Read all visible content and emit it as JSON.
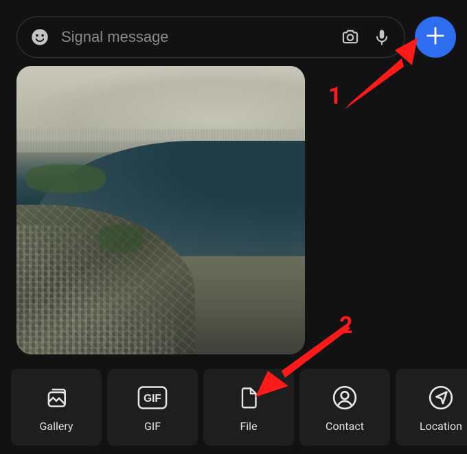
{
  "composer": {
    "placeholder": "Signal message",
    "value": ""
  },
  "plus_button": {
    "accent": "#2e6cf0"
  },
  "attachments": {
    "items": [
      {
        "id": "gallery",
        "label": "Gallery",
        "icon": "gallery-icon"
      },
      {
        "id": "gif",
        "label": "GIF",
        "icon": "gif-icon"
      },
      {
        "id": "file",
        "label": "File",
        "icon": "file-icon"
      },
      {
        "id": "contact",
        "label": "Contact",
        "icon": "contact-icon"
      },
      {
        "id": "location",
        "label": "Location",
        "icon": "location-icon"
      }
    ]
  },
  "annotations": {
    "step1": "1",
    "step2": "2",
    "color": "#ff1a1a"
  }
}
